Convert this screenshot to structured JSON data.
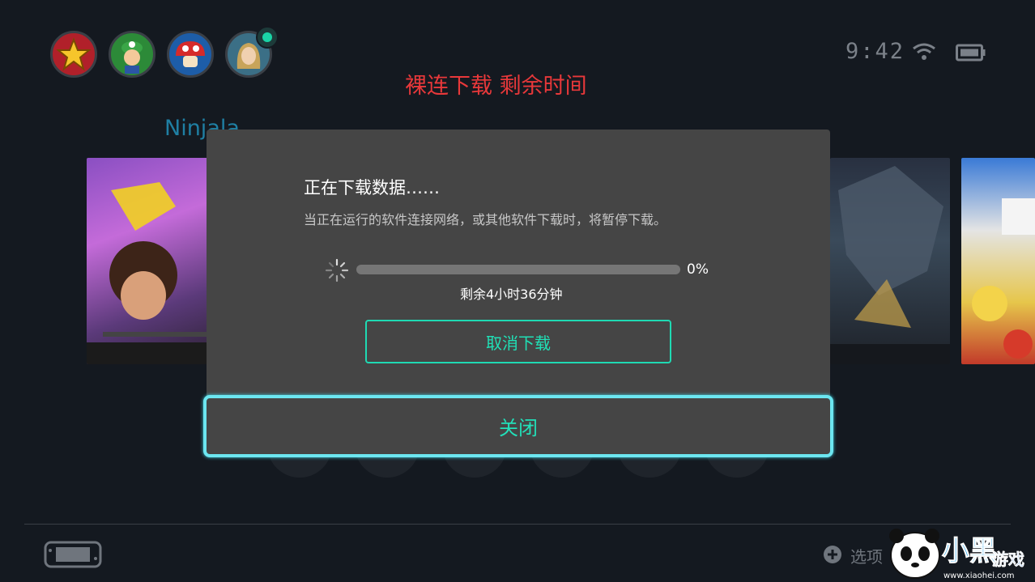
{
  "status_bar": {
    "time": "9:42"
  },
  "headline": "裸连下载 剩余时间",
  "selected_game_title": "Ninjala",
  "dialog": {
    "title": "正在下载数据……",
    "subtitle": "当正在运行的软件连接网络，或其他软件下载时，将暂停下载。",
    "progress_percent_label": "0%",
    "progress_fraction": 0.0,
    "remaining_time": "剩余4小时36分钟",
    "cancel_label": "取消下载",
    "close_label": "关闭"
  },
  "footer": {
    "options_label": "选项"
  },
  "watermark": {
    "brand": "小黑游戏",
    "url": "www.xiaohei.com"
  },
  "colors": {
    "accent": "#1fdab3",
    "focus_border": "#6ce6f0",
    "headline": "#e8383a",
    "background": "#141920"
  }
}
